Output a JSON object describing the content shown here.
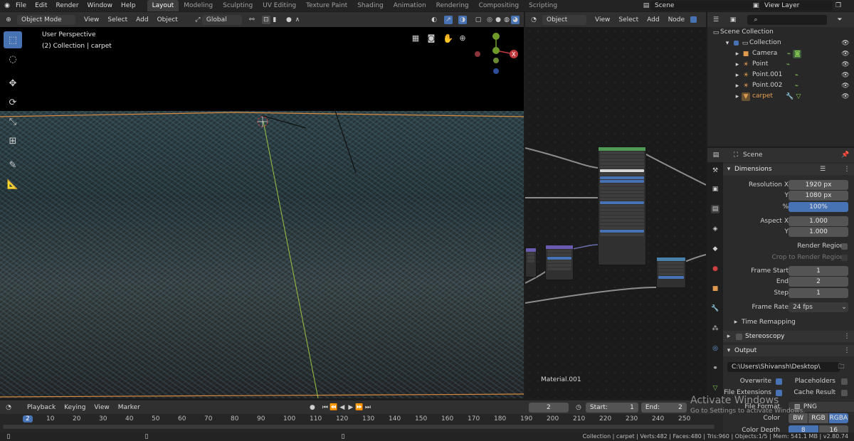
{
  "menu": {
    "items": [
      "File",
      "Edit",
      "Render",
      "Window",
      "Help"
    ],
    "workspaces": [
      "Layout",
      "Modeling",
      "Sculpting",
      "UV Editing",
      "Texture Paint",
      "Shading",
      "Animation",
      "Rendering",
      "Compositing",
      "Scripting"
    ],
    "active_workspace": "Layout",
    "scene": "Scene",
    "view_layer": "View Layer"
  },
  "viewport": {
    "mode": "Object Mode",
    "menus": [
      "View",
      "Select",
      "Add",
      "Object"
    ],
    "transform": "Global",
    "overlay_title": "User Perspective",
    "overlay_subtitle": "(2) Collection | carpet",
    "gizmo_x": "X"
  },
  "node_editor": {
    "type": "Object",
    "menus": [
      "View",
      "Select",
      "Add",
      "Node"
    ],
    "material": "Material.001"
  },
  "outliner": {
    "root": "Scene Collection",
    "items": [
      {
        "name": "Collection",
        "level": 1
      },
      {
        "name": "Camera",
        "level": 2
      },
      {
        "name": "Point",
        "level": 2
      },
      {
        "name": "Point.001",
        "level": 2
      },
      {
        "name": "Point.002",
        "level": 2
      },
      {
        "name": "carpet",
        "level": 2
      }
    ]
  },
  "properties": {
    "context": "Scene",
    "dimensions": {
      "title": "Dimensions",
      "resolution_x_label": "Resolution X",
      "resolution_x": "1920 px",
      "y_label": "Y",
      "resolution_y": "1080 px",
      "percent_label": "%",
      "percent": "100%",
      "aspect_x_label": "Aspect X",
      "aspect_x": "1.000",
      "aspect_y_label": "Y",
      "aspect_y": "1.000",
      "render_region": "Render Region",
      "crop_region": "Crop to Render Region",
      "frame_start_label": "Frame Start",
      "frame_start": "1",
      "end_label": "End",
      "frame_end": "2",
      "step_label": "Step",
      "frame_step": "1",
      "frame_rate_label": "Frame Rate",
      "frame_rate": "24 fps",
      "time_remapping": "Time Remapping"
    },
    "stereoscopy": "Stereoscopy",
    "output": {
      "title": "Output",
      "path": "C:\\Users\\Shivansh\\Desktop\\",
      "overwrite": "Overwrite",
      "placeholders": "Placeholders",
      "file_extensions": "File Extensions",
      "cache_result": "Cache Result",
      "file_format_label": "File Format",
      "file_format": "PNG",
      "color_label": "Color",
      "color_modes": [
        "BW",
        "RGB",
        "RGBA"
      ],
      "color_depth_label": "Color Depth",
      "color_depth": [
        "8",
        "16"
      ]
    }
  },
  "timeline": {
    "menus": [
      "Playback",
      "Keying",
      "View",
      "Marker"
    ],
    "current_frame": "2",
    "start_label": "Start:",
    "start": "1",
    "end_label": "End:",
    "end": "2",
    "ruler": [
      "2",
      "10",
      "20",
      "30",
      "40",
      "50",
      "60",
      "70",
      "80",
      "90",
      "100",
      "110",
      "120",
      "130",
      "140",
      "150",
      "160",
      "170",
      "180",
      "190",
      "200",
      "210",
      "220",
      "230",
      "240",
      "250"
    ]
  },
  "status": "Collection | carpet | Verts:482 | Faces:480 | Tris:960 | Objects:1/5 | Mem: 541.1 MB | v2.80.74",
  "watermark": {
    "title": "Activate Windows",
    "subtitle": "Go to Settings to activate Windows."
  }
}
